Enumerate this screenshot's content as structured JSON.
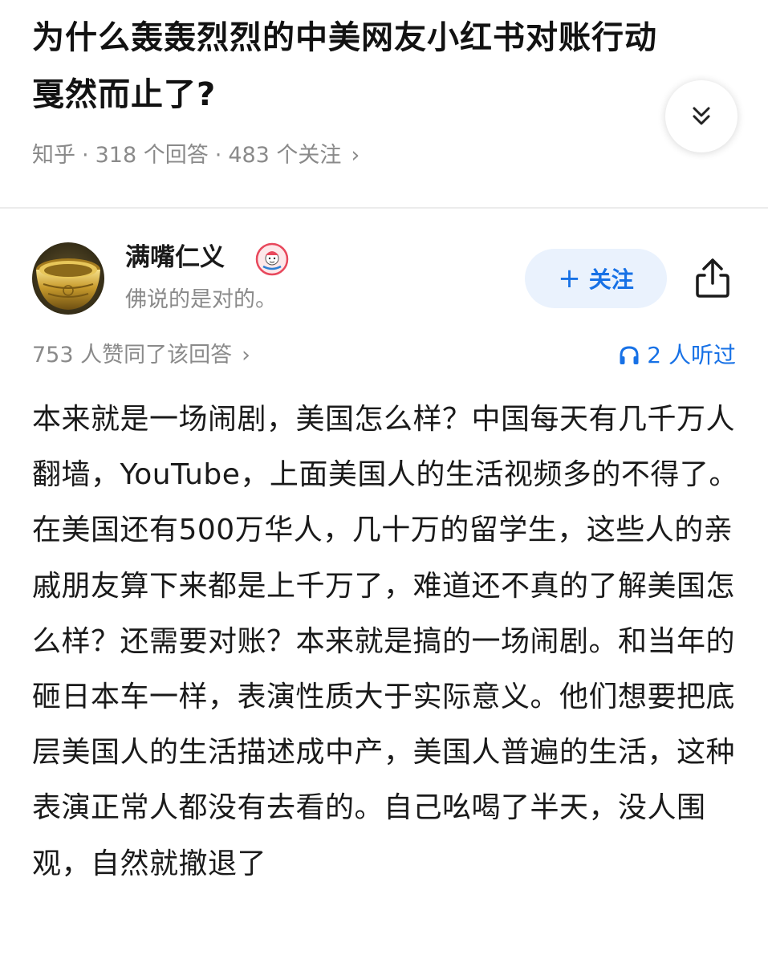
{
  "question": {
    "title": "为什么轰轰烈烈的中美网友小红书对账行动戛然而止了?",
    "source": "知乎",
    "separator": "·",
    "answers_count": "318 个回答",
    "followers_count": "483 个关注",
    "chevron": "›",
    "expand_icon": "double-chevron-down-icon"
  },
  "author": {
    "name": "满嘴仁义",
    "bio": "佛说的是对的。",
    "badge_icon": "cartoon-badge-icon",
    "follow_label": "关注",
    "follow_plus": "+",
    "share_icon": "share-icon"
  },
  "stats": {
    "upvote_text": "753 人赞同了该回答",
    "chevron": "›",
    "listened_text": "2 人听过",
    "listen_icon": "headphones-icon"
  },
  "answer": {
    "body": "本来就是一场闹剧，美国怎么样？中国每天有几千万人翻墙，YouTube，上面美国人的生活视频多的不得了。在美国还有500万华人，几十万的留学生，这些人的亲戚朋友算下来都是上千万了，难道还不真的了解美国怎么样？还需要对账？本来就是搞的一场闹剧。和当年的砸日本车一样，表演性质大于实际意义。他们想要把底层美国人的生活描述成中产，美国人普遍的生活，这种表演正常人都没有去看的。自己吆喝了半天，没人围观，自然就撤退了"
  },
  "colors": {
    "accent": "#1771e6",
    "follow_bg": "#eaf2fd",
    "muted": "#8a8a8a",
    "text": "#1a1a1a"
  }
}
